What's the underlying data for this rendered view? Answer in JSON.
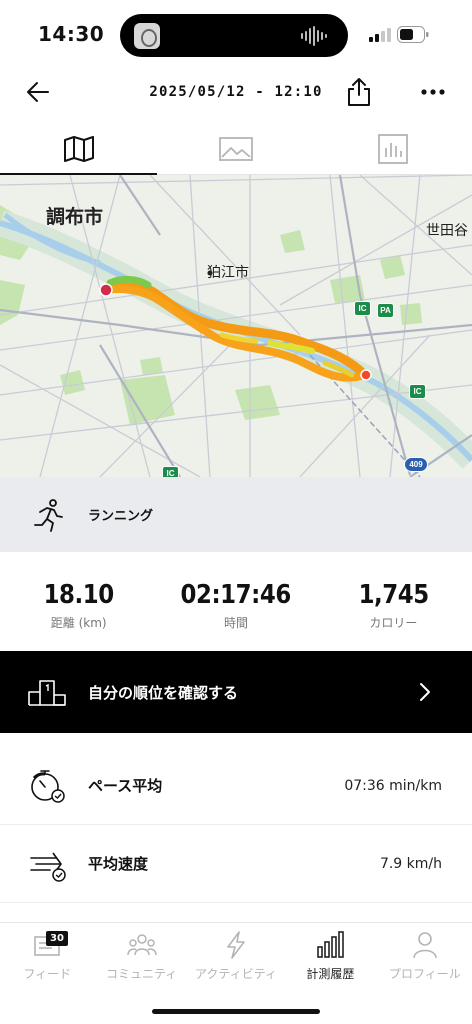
{
  "status_bar": {
    "time": "14:30"
  },
  "header": {
    "title": "2025/05/12 - 12:10"
  },
  "tabs": [
    {
      "name": "map",
      "active": true
    },
    {
      "name": "photos",
      "active": false
    },
    {
      "name": "stats",
      "active": false
    }
  ],
  "map": {
    "labels": {
      "city_main": "調布市",
      "city_komae": "狛江市",
      "city_setagaya": "世田谷"
    },
    "badges": {
      "ic": "IC",
      "pa": "PA",
      "route": "409"
    },
    "route_color": "#f59a14"
  },
  "activity": {
    "type": "ランニング"
  },
  "stats": [
    {
      "value": "18.10",
      "label": "距離 (km)"
    },
    {
      "value": "02:17:46",
      "label": "時間"
    },
    {
      "value": "1,745",
      "label": "カロリー"
    }
  ],
  "ranking": {
    "label": "自分の順位を確認する"
  },
  "metrics": [
    {
      "name": "ペース平均",
      "value": "07:36 min/km",
      "icon": "stopwatch-icon"
    },
    {
      "name": "平均速度",
      "value": "7.9 km/h",
      "icon": "speed-icon"
    }
  ],
  "bottom_nav": {
    "items": [
      {
        "label": "フィード",
        "icon": "feed-icon",
        "badge": "30",
        "active": false
      },
      {
        "label": "コミュニティ",
        "icon": "community-icon",
        "active": false
      },
      {
        "label": "アクティビティ",
        "icon": "lightning-icon",
        "active": false
      },
      {
        "label": "計測履歴",
        "icon": "bar-chart-icon",
        "active": true
      },
      {
        "label": "プロフィール",
        "icon": "person-icon",
        "active": false
      }
    ]
  }
}
